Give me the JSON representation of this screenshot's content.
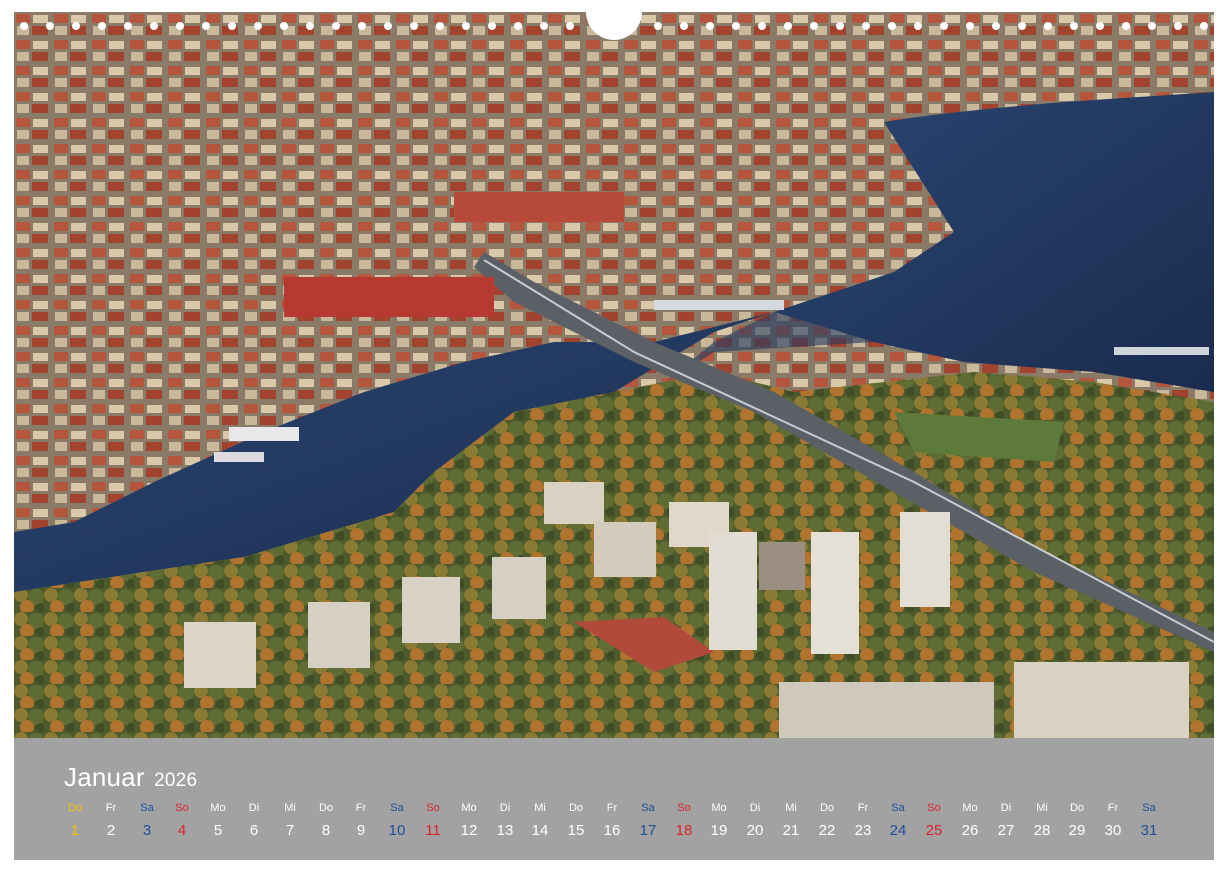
{
  "calendar": {
    "month": "Januar",
    "year": "2026",
    "days": [
      {
        "wd": "Do",
        "d": "1",
        "kind": "hol"
      },
      {
        "wd": "Fr",
        "d": "2",
        "kind": "week"
      },
      {
        "wd": "Sa",
        "d": "3",
        "kind": "sat"
      },
      {
        "wd": "So",
        "d": "4",
        "kind": "sun"
      },
      {
        "wd": "Mo",
        "d": "5",
        "kind": "week"
      },
      {
        "wd": "Di",
        "d": "6",
        "kind": "week"
      },
      {
        "wd": "Mi",
        "d": "7",
        "kind": "week"
      },
      {
        "wd": "Do",
        "d": "8",
        "kind": "week"
      },
      {
        "wd": "Fr",
        "d": "9",
        "kind": "week"
      },
      {
        "wd": "Sa",
        "d": "10",
        "kind": "sat"
      },
      {
        "wd": "So",
        "d": "11",
        "kind": "sun"
      },
      {
        "wd": "Mo",
        "d": "12",
        "kind": "week"
      },
      {
        "wd": "Di",
        "d": "13",
        "kind": "week"
      },
      {
        "wd": "Mi",
        "d": "14",
        "kind": "week"
      },
      {
        "wd": "Do",
        "d": "15",
        "kind": "week"
      },
      {
        "wd": "Fr",
        "d": "16",
        "kind": "week"
      },
      {
        "wd": "Sa",
        "d": "17",
        "kind": "sat"
      },
      {
        "wd": "So",
        "d": "18",
        "kind": "sun"
      },
      {
        "wd": "Mo",
        "d": "19",
        "kind": "week"
      },
      {
        "wd": "Di",
        "d": "20",
        "kind": "week"
      },
      {
        "wd": "Mi",
        "d": "21",
        "kind": "week"
      },
      {
        "wd": "Do",
        "d": "22",
        "kind": "week"
      },
      {
        "wd": "Fr",
        "d": "23",
        "kind": "week"
      },
      {
        "wd": "Sa",
        "d": "24",
        "kind": "sat"
      },
      {
        "wd": "So",
        "d": "25",
        "kind": "sun"
      },
      {
        "wd": "Mo",
        "d": "26",
        "kind": "week"
      },
      {
        "wd": "Di",
        "d": "27",
        "kind": "week"
      },
      {
        "wd": "Mi",
        "d": "28",
        "kind": "week"
      },
      {
        "wd": "Do",
        "d": "29",
        "kind": "week"
      },
      {
        "wd": "Fr",
        "d": "30",
        "kind": "week"
      },
      {
        "wd": "Sa",
        "d": "31",
        "kind": "sat"
      }
    ]
  },
  "colors": {
    "strip": "#a2a2a2",
    "weekday": "#ffffff",
    "saturday": "#1d4f9b",
    "sunday": "#d8242a",
    "holiday": "#f2c200"
  },
  "photo": {
    "icon": "aerial-city-photo"
  }
}
